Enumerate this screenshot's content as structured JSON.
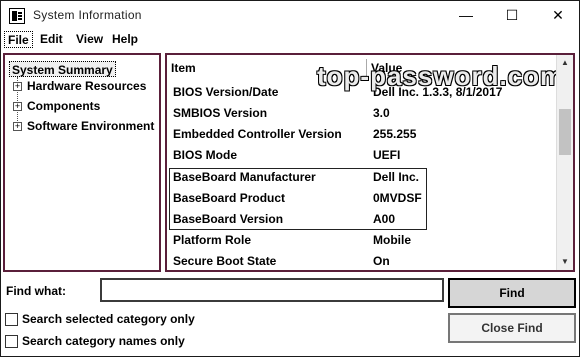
{
  "window": {
    "title": "System Information",
    "minimize_glyph": "—",
    "maximize_glyph": "☐",
    "close_glyph": "✕"
  },
  "menu": {
    "items": [
      {
        "label": "File",
        "selected": true
      },
      {
        "label": "Edit",
        "selected": false
      },
      {
        "label": "View",
        "selected": false
      },
      {
        "label": "Help",
        "selected": false
      }
    ]
  },
  "tree": {
    "root": "System Summary",
    "children": [
      {
        "label": "Hardware Resources",
        "expander": "+"
      },
      {
        "label": "Components",
        "expander": "+"
      },
      {
        "label": "Software Environment",
        "expander": "+"
      }
    ]
  },
  "details": {
    "columns": {
      "item": "Item",
      "value": "Value"
    },
    "rows": [
      {
        "item": "BIOS Version/Date",
        "value": "Dell Inc. 1.3.3, 8/1/2017"
      },
      {
        "item": "SMBIOS Version",
        "value": "3.0"
      },
      {
        "item": "Embedded Controller Version",
        "value": "255.255"
      },
      {
        "item": "BIOS Mode",
        "value": "UEFI"
      },
      {
        "item": "BaseBoard Manufacturer",
        "value": "Dell Inc."
      },
      {
        "item": "BaseBoard Product",
        "value": "0MVDSF"
      },
      {
        "item": "BaseBoard Version",
        "value": "A00"
      },
      {
        "item": "Platform Role",
        "value": "Mobile"
      },
      {
        "item": "Secure Boot State",
        "value": "On"
      }
    ],
    "watermark": "top-password.com"
  },
  "scrollbar": {
    "up_glyph": "▲",
    "down_glyph": "▼"
  },
  "find": {
    "label": "Find what:",
    "value": "",
    "find_button": "Find",
    "close_find_button": "Close Find",
    "search_selected": {
      "label": "Search selected category only",
      "checked": false
    },
    "search_names": {
      "label": "Search category names only",
      "checked": false
    }
  }
}
